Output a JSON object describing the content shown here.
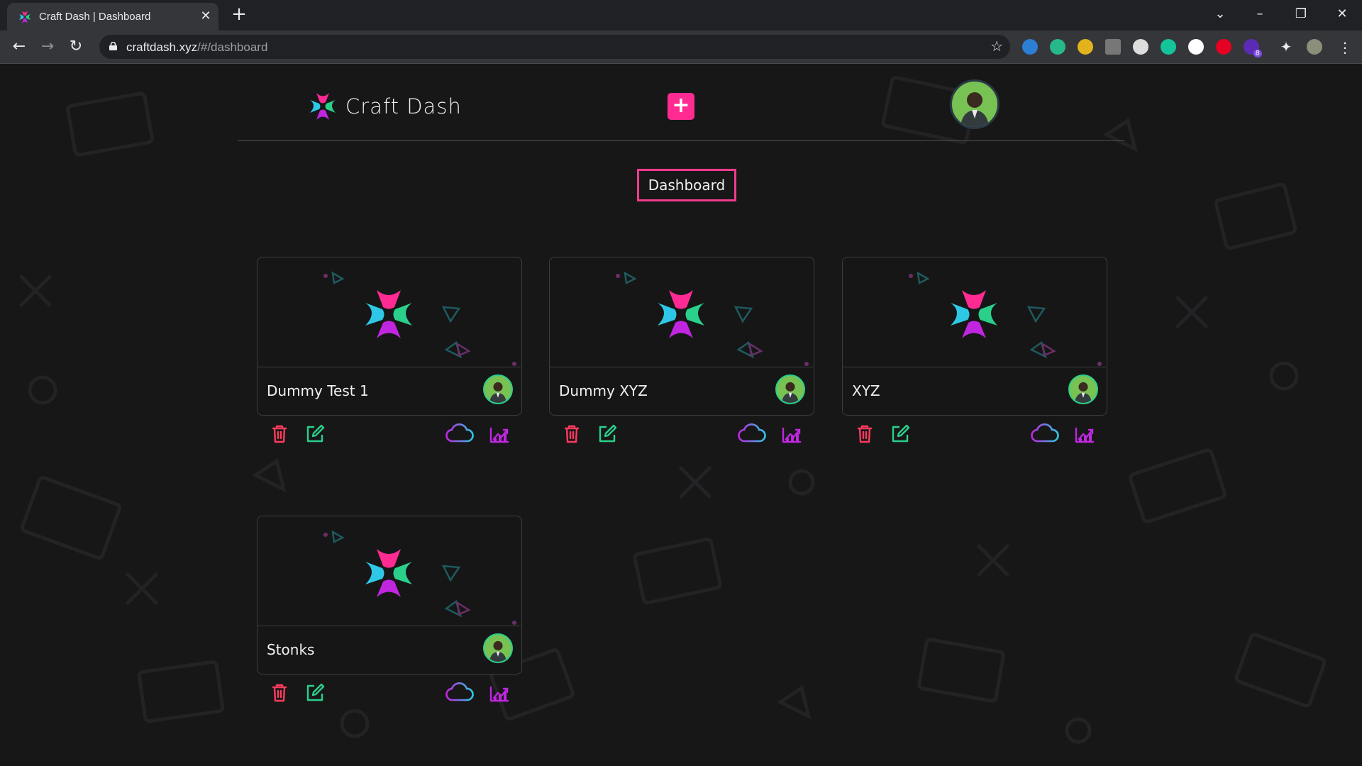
{
  "browser": {
    "tab_title": "Craft Dash | Dashboard",
    "url_host": "craftdash.xyz",
    "url_path": "/#/dashboard",
    "extension_badge": "8"
  },
  "app": {
    "brand_name": "Craft Dash",
    "add_button_label": "+",
    "page_heading": "Dashboard",
    "colors": {
      "accent": "#ff2b92",
      "teal": "#2ad08a",
      "cyan": "#2ec8e6",
      "purple": "#c026e0",
      "danger": "#ff3a5c"
    }
  },
  "projects": [
    {
      "name": "Dummy Test 1"
    },
    {
      "name": "Dummy XYZ"
    },
    {
      "name": "XYZ"
    },
    {
      "name": "Stonks"
    }
  ],
  "card_actions": {
    "delete_icon": "trash-icon",
    "edit_icon": "edit-icon",
    "cloud_icon": "cloud-icon",
    "analytics_icon": "chart-icon"
  }
}
